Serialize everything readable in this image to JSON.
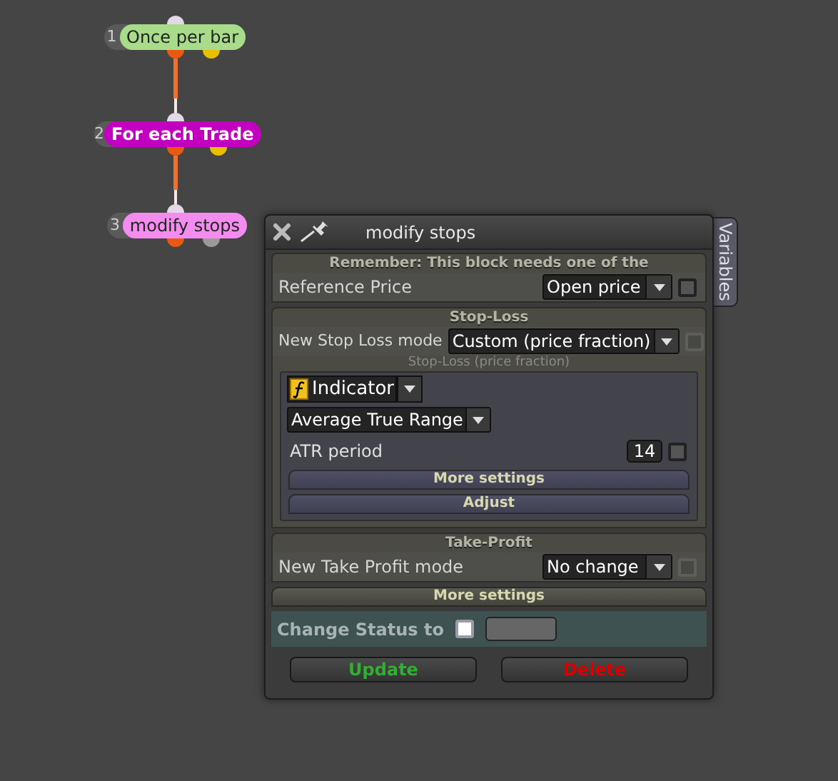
{
  "nodes": [
    {
      "number": "1",
      "label": "Once per bar",
      "color": "#a8dc8a",
      "bold": false,
      "ports": [
        {
          "color": "#e85a10"
        },
        {
          "color": "#e8c000"
        }
      ]
    },
    {
      "number": "2",
      "label": "For each Trade",
      "color": "#c400c0",
      "bold": true,
      "ports": [
        {
          "color": "#e85a10"
        },
        {
          "color": "#e8c000"
        }
      ]
    },
    {
      "number": "3",
      "label": "modify stops",
      "color": "#f48cf0",
      "bold": false,
      "ports": [
        {
          "color": "#e85a10"
        },
        {
          "color": "#9a9a9a"
        }
      ]
    }
  ],
  "dialog": {
    "title": "modify stops",
    "side_tab": "Variables",
    "notice": {
      "header": "Remember: This block needs one of the",
      "label": "Reference Price",
      "value": "Open price",
      "checkbox": {
        "checked": false,
        "disabled": false
      }
    },
    "stop_loss": {
      "header": "Stop-Loss",
      "label": "New Stop Loss mode",
      "value": "Custom (price fraction)",
      "checkbox": {
        "checked": false,
        "disabled": true
      },
      "caption": "Stop-Loss (price fraction)",
      "source": "Indicator",
      "indicator": "Average True Range",
      "param": {
        "label": "ATR period",
        "value": "14",
        "checked": false
      },
      "buttons": [
        "More settings",
        "Adjust"
      ]
    },
    "take_profit": {
      "header": "Take-Profit",
      "label": "New Take Profit mode",
      "value": "No change",
      "checkbox": {
        "checked": false,
        "disabled": true
      }
    },
    "more_settings": "More settings",
    "status": {
      "label": "Change Status to",
      "checked": false
    },
    "actions": [
      {
        "label": "Update",
        "kind": "update"
      },
      {
        "label": "Delete",
        "kind": "delete"
      }
    ]
  }
}
